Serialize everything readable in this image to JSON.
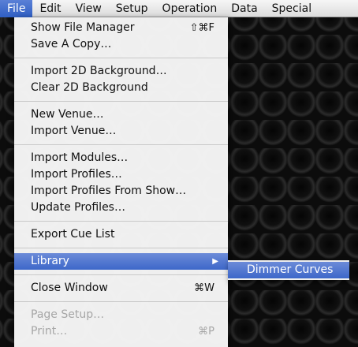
{
  "menubar": {
    "items": [
      "File",
      "Edit",
      "View",
      "Setup",
      "Operation",
      "Data",
      "Special"
    ]
  },
  "file_menu": {
    "show_file_manager": "Show File Manager",
    "show_file_manager_shortcut": "⇧⌘F",
    "save_a_copy": "Save A Copy…",
    "import_2d_background": "Import 2D Background…",
    "clear_2d_background": "Clear 2D Background",
    "new_venue": "New Venue…",
    "import_venue": "Import Venue…",
    "import_modules": "Import Modules…",
    "import_profiles": "Import Profiles…",
    "import_profiles_from_show": "Import Profiles From Show…",
    "update_profiles": "Update Profiles…",
    "export_cue_list": "Export Cue List",
    "library": "Library",
    "library_arrow": "▶",
    "close_window": "Close Window",
    "close_window_shortcut": "⌘W",
    "page_setup": "Page Setup…",
    "print": "Print…",
    "print_shortcut": "⌘P"
  },
  "library_submenu": {
    "dimmer_curves": "Dimmer Curves"
  }
}
